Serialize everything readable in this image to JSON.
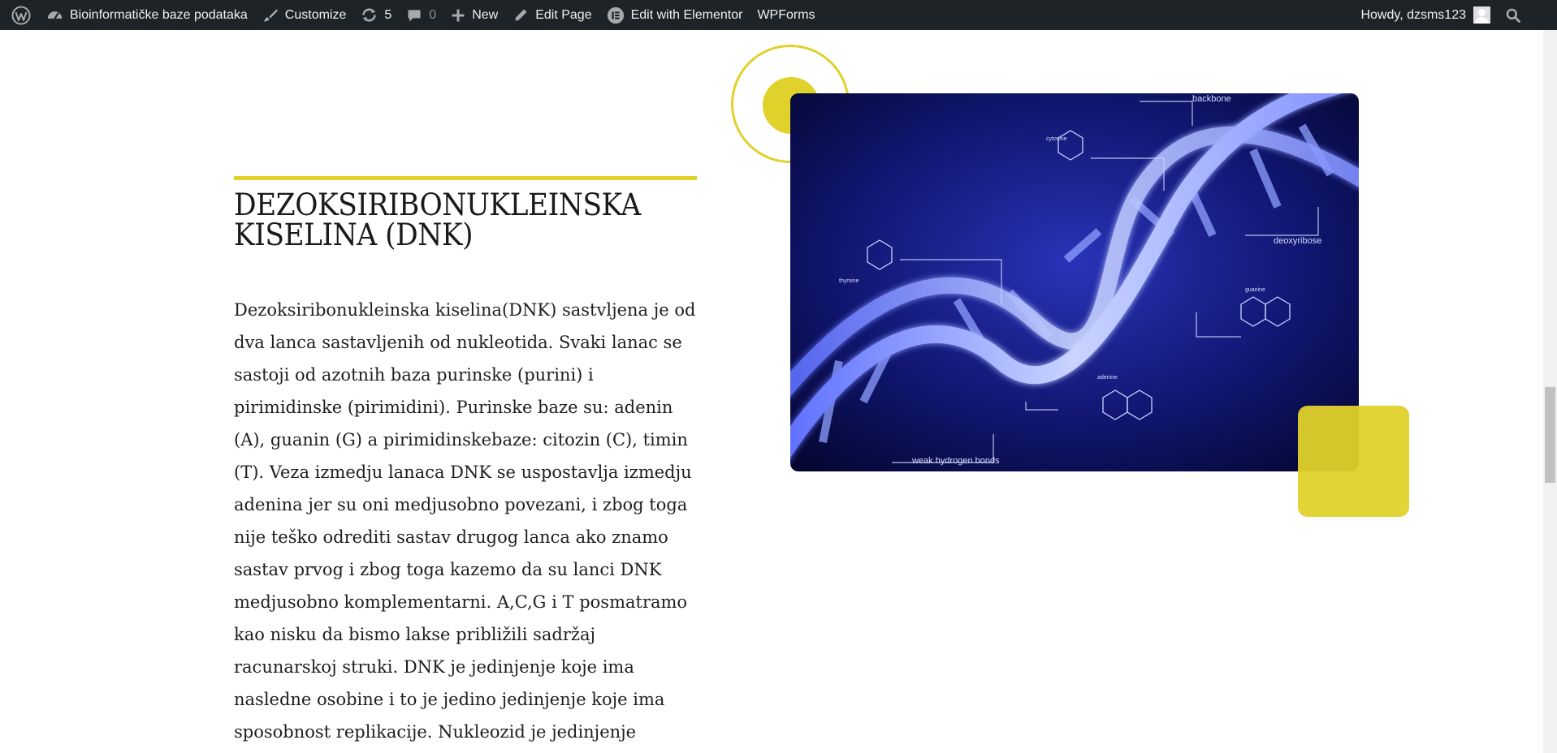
{
  "admin_bar": {
    "site_name": "Bioinformatičke baze podataka",
    "customize": "Customize",
    "updates_count": "5",
    "comments_count": "0",
    "new_label": "New",
    "edit_page": "Edit Page",
    "edit_elementor": "Edit with Elementor",
    "wpforms": "WPForms",
    "howdy": "Howdy, dzsms123"
  },
  "content": {
    "title": "DEZOKSIRIBONUKLEINSKA KISELINA (DNK)",
    "body": "Dezoksiribonukleinska kiselina(DNK) sastvljena je od dva lanca sastavljenih od nukleotida. Svaki lanac se sastoji od azotnih baza purinske (purini) i pirimidinske (pirimidini). Purinske baze su: adenin (A), guanin (G) a pirimidinskebaze: citozin (C), timin (T). Veza izmedju lanaca DNK se uspostavlja izmedju adenina jer su oni medjusobno povezani, i zbog toga nije teško odrediti sastav drugog lanca ako znamo sastav prvog i zbog toga kazemo da su lanci DNK medjusobno komplementarni. A,C,G i T posmatramo kao nisku da bismo lakse približili sadržaj racunarskoj struki. DNK je jedinjenje koje ima nasledne osobine i to je jedino jedinjenje koje ima sposobnost replikacije. Nukleozid je jedinjenje"
  },
  "image_labels": {
    "backbone": "backbone",
    "cytosine": "cytosine",
    "thymine": "thymine",
    "deoxyribose": "deoxyribose",
    "guanine": "guanine",
    "adenine": "adenine",
    "hydrogen_bonds": "weak hydrogen bonds"
  },
  "colors": {
    "admin_bar_bg": "#1d2327",
    "accent_yellow": "#e0d12b",
    "image_bg": "#0a0c4a"
  }
}
